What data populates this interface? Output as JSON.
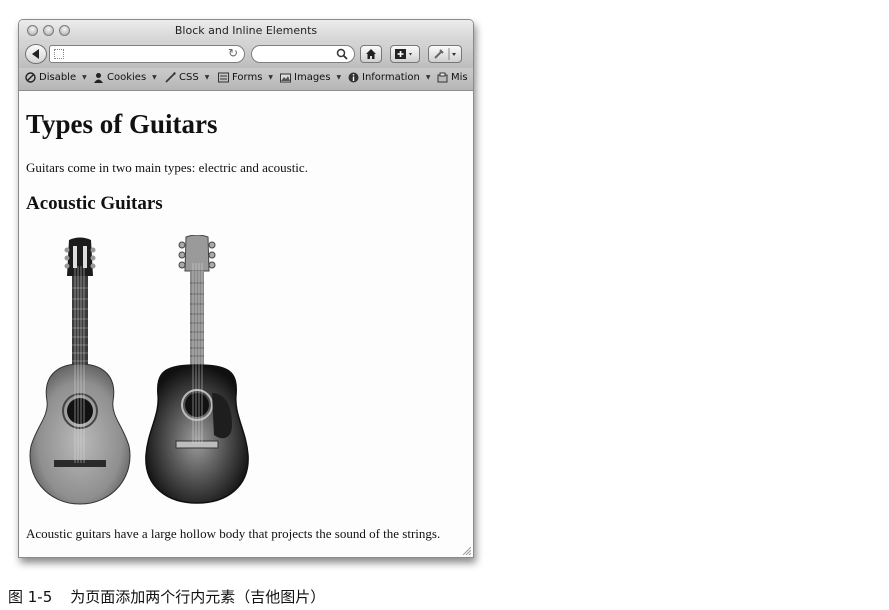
{
  "window": {
    "title": "Block and Inline Elements"
  },
  "devbar": {
    "items": [
      {
        "label": "Disable",
        "icon": "disable-icon"
      },
      {
        "label": "Cookies",
        "icon": "cookies-icon"
      },
      {
        "label": "CSS",
        "icon": "css-icon"
      },
      {
        "label": "Forms",
        "icon": "forms-icon"
      },
      {
        "label": "Images",
        "icon": "images-icon"
      },
      {
        "label": "Information",
        "icon": "information-icon"
      },
      {
        "label": "Mis",
        "icon": "misc-icon"
      }
    ]
  },
  "page": {
    "heading": "Types of Guitars",
    "intro": "Guitars come in two main types: electric and acoustic.",
    "subheading": "Acoustic Guitars",
    "body": "Acoustic guitars have a large hollow body that projects the sound of the strings."
  },
  "caption": {
    "number": "图 1-5",
    "text": "为页面添加两个行内元素（吉他图片）"
  }
}
